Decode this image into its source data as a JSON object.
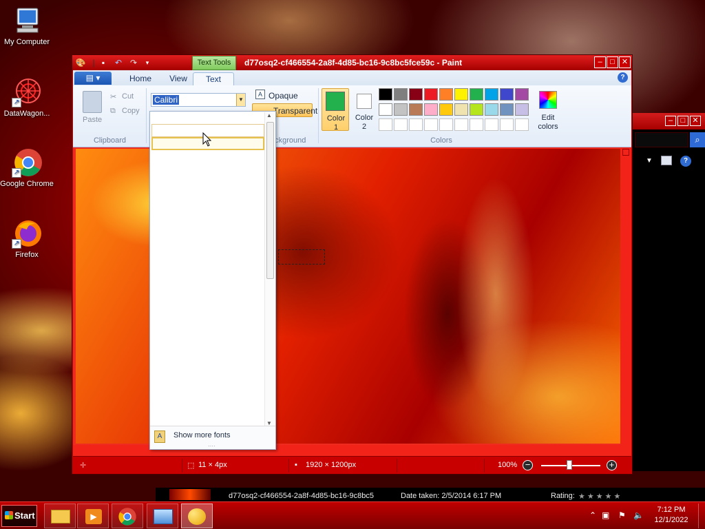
{
  "desktop": {
    "icons": [
      {
        "label": "My Computer"
      },
      {
        "label": "DataWagon..."
      },
      {
        "label": "Google Chrome"
      },
      {
        "label": "Firefox"
      }
    ]
  },
  "paint": {
    "title": "d77osq2-cf466554-2a8f-4d85-bc16-9c8bc5fce59c - Paint",
    "contextual_tab": "Text Tools",
    "tabs": [
      "Home",
      "View",
      "Text"
    ],
    "active_tab": "Text",
    "clipboard": {
      "paste": "Paste",
      "cut": "Cut",
      "copy": "Copy",
      "group": "Clipboard"
    },
    "font": {
      "selected": "Calibri",
      "show_more": "Show more fonts"
    },
    "background": {
      "opaque": "Opaque",
      "transparent": "Transparent",
      "group": "Background"
    },
    "colors": {
      "color1_label": "Color 1",
      "color1_line1": "Color",
      "color1_line2": "1",
      "color2_line1": "Color",
      "color2_line2": "2",
      "color1": "#22b14c",
      "color2": "#ffffff",
      "edit_line1": "Edit",
      "edit_line2": "colors",
      "group": "Colors",
      "palette_row1": [
        "#000000",
        "#7f7f7f",
        "#880015",
        "#ed1c24",
        "#ff7f27",
        "#fff200",
        "#22b14c",
        "#00a2e8",
        "#3f48cc",
        "#a349a4"
      ],
      "palette_row2": [
        "#ffffff",
        "#c3c3c3",
        "#b97a57",
        "#ffaec9",
        "#ffc90e",
        "#efe4b0",
        "#b5e61d",
        "#99d9ea",
        "#7092be",
        "#c8bfe7"
      ]
    },
    "status": {
      "selection": "11 × 4px",
      "image_size": "1920 × 1200px",
      "zoom": "100%"
    }
  },
  "bg_viewer": {
    "filename": "d77osq2-cf466554-2a8f-4d85-bc16-9c8bc5",
    "date_taken": "Date taken: 2/5/2014 6:17 PM",
    "rating": "Rating:"
  },
  "taskbar": {
    "start": "Start",
    "time": "7:12 PM",
    "date": "12/1/2022"
  }
}
